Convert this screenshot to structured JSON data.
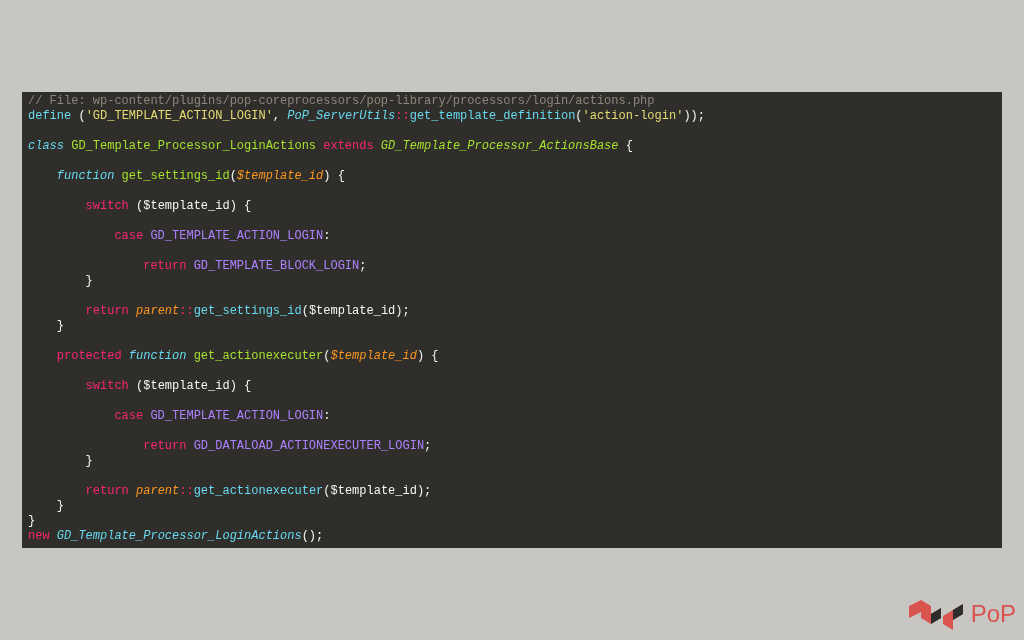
{
  "code_editor": {
    "lines": [
      {
        "kind": "code",
        "tokens": [
          {
            "kind": "comment",
            "text": "// File: wp-content/plugins/pop-coreprocessors/pop-library/processors/login/actions.php"
          }
        ]
      },
      {
        "kind": "code",
        "tokens": [
          {
            "kind": "support",
            "text": "define"
          },
          {
            "kind": "plain",
            "text": " ("
          },
          {
            "kind": "string",
            "text": "'GD_TEMPLATE_ACTION_LOGIN'"
          },
          {
            "kind": "plain",
            "text": ", "
          },
          {
            "kind": "classref",
            "text": "PoP_ServerUtils"
          },
          {
            "kind": "keyword",
            "text": "::"
          },
          {
            "kind": "support",
            "text": "get_template_definition"
          },
          {
            "kind": "plain",
            "text": "("
          },
          {
            "kind": "string",
            "text": "'action-login'"
          },
          {
            "kind": "plain",
            "text": "));"
          }
        ]
      },
      {
        "kind": "blank"
      },
      {
        "kind": "code",
        "tokens": [
          {
            "kind": "storage",
            "text": "class"
          },
          {
            "kind": "entity",
            "text": " GD_Template_Processor_LoginActions"
          },
          {
            "kind": "keyword",
            "text": " extends"
          },
          {
            "kind": "inherited",
            "text": " GD_Template_Processor_ActionsBase"
          },
          {
            "kind": "plain",
            "text": " {"
          }
        ]
      },
      {
        "kind": "blank"
      },
      {
        "kind": "code",
        "tokens": [
          {
            "kind": "storage",
            "text": "    function"
          },
          {
            "kind": "entity",
            "text": " get_settings_id"
          },
          {
            "kind": "plain",
            "text": "("
          },
          {
            "kind": "param",
            "text": "$template_id"
          },
          {
            "kind": "plain",
            "text": ") {"
          }
        ]
      },
      {
        "kind": "blank"
      },
      {
        "kind": "code",
        "tokens": [
          {
            "kind": "keyword",
            "text": "        switch"
          },
          {
            "kind": "plain",
            "text": " ($template_id) {"
          }
        ]
      },
      {
        "kind": "blank"
      },
      {
        "kind": "code",
        "tokens": [
          {
            "kind": "keyword",
            "text": "            case"
          },
          {
            "kind": "constant",
            "text": " GD_TEMPLATE_ACTION_LOGIN"
          },
          {
            "kind": "plain",
            "text": ":"
          }
        ]
      },
      {
        "kind": "blank"
      },
      {
        "kind": "code",
        "tokens": [
          {
            "kind": "keyword",
            "text": "                return"
          },
          {
            "kind": "constant",
            "text": " GD_TEMPLATE_BLOCK_LOGIN"
          },
          {
            "kind": "plain",
            "text": ";"
          }
        ]
      },
      {
        "kind": "code",
        "tokens": [
          {
            "kind": "plain",
            "text": "        }"
          }
        ]
      },
      {
        "kind": "blank"
      },
      {
        "kind": "code",
        "tokens": [
          {
            "kind": "keyword",
            "text": "        return"
          },
          {
            "kind": "param",
            "text": " parent"
          },
          {
            "kind": "keyword",
            "text": "::"
          },
          {
            "kind": "support",
            "text": "get_settings_id"
          },
          {
            "kind": "plain",
            "text": "($template_id);"
          }
        ]
      },
      {
        "kind": "code",
        "tokens": [
          {
            "kind": "plain",
            "text": "    }"
          }
        ]
      },
      {
        "kind": "blank"
      },
      {
        "kind": "code",
        "tokens": [
          {
            "kind": "keyword",
            "text": "    protected"
          },
          {
            "kind": "storage",
            "text": " function"
          },
          {
            "kind": "entity",
            "text": " get_actionexecuter"
          },
          {
            "kind": "plain",
            "text": "("
          },
          {
            "kind": "param",
            "text": "$template_id"
          },
          {
            "kind": "plain",
            "text": ") {"
          }
        ]
      },
      {
        "kind": "blank"
      },
      {
        "kind": "code",
        "tokens": [
          {
            "kind": "keyword",
            "text": "        switch"
          },
          {
            "kind": "plain",
            "text": " ($template_id) {"
          }
        ]
      },
      {
        "kind": "blank"
      },
      {
        "kind": "code",
        "tokens": [
          {
            "kind": "keyword",
            "text": "            case"
          },
          {
            "kind": "constant",
            "text": " GD_TEMPLATE_ACTION_LOGIN"
          },
          {
            "kind": "plain",
            "text": ":"
          }
        ]
      },
      {
        "kind": "blank"
      },
      {
        "kind": "code",
        "tokens": [
          {
            "kind": "keyword",
            "text": "                return"
          },
          {
            "kind": "constant",
            "text": " GD_DATALOAD_ACTIONEXECUTER_LOGIN"
          },
          {
            "kind": "plain",
            "text": ";"
          }
        ]
      },
      {
        "kind": "code",
        "tokens": [
          {
            "kind": "plain",
            "text": "        }"
          }
        ]
      },
      {
        "kind": "blank"
      },
      {
        "kind": "code",
        "tokens": [
          {
            "kind": "keyword",
            "text": "        return"
          },
          {
            "kind": "param",
            "text": " parent"
          },
          {
            "kind": "keyword",
            "text": "::"
          },
          {
            "kind": "support",
            "text": "get_actionexecuter"
          },
          {
            "kind": "plain",
            "text": "($template_id);"
          }
        ]
      },
      {
        "kind": "code",
        "tokens": [
          {
            "kind": "plain",
            "text": "    }"
          }
        ]
      },
      {
        "kind": "code",
        "tokens": [
          {
            "kind": "plain",
            "text": "}"
          }
        ]
      },
      {
        "kind": "code",
        "tokens": [
          {
            "kind": "keyword",
            "text": "new"
          },
          {
            "kind": "classref",
            "text": " GD_Template_Processor_LoginActions"
          },
          {
            "kind": "plain",
            "text": "();"
          }
        ]
      }
    ]
  },
  "logo": {
    "text": "PoP"
  }
}
